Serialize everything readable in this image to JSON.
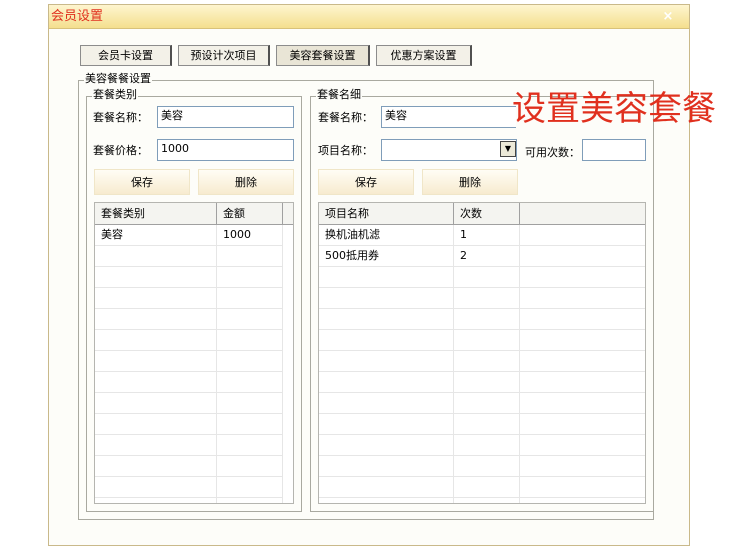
{
  "window": {
    "title": "会员设置",
    "close": "×"
  },
  "tabs": [
    {
      "label": "会员卡设置"
    },
    {
      "label": "预设计次项目"
    },
    {
      "label": "美容套餐设置"
    },
    {
      "label": "优惠方案设置"
    }
  ],
  "group": {
    "legend": "美容餐餐设置"
  },
  "left": {
    "legend": "套餐类别",
    "name_label": "套餐名称：",
    "name_value": "美容",
    "price_label": "套餐价格：",
    "price_value": "1000",
    "save": "保存",
    "delete": "删除",
    "columns": [
      "套餐类别",
      "金额"
    ],
    "rows": [
      [
        "美容",
        "1000"
      ]
    ]
  },
  "right": {
    "legend": "套餐名细",
    "name_label": "套餐名称：",
    "name_value": "美容",
    "item_label": "项目名称：",
    "item_value": "",
    "count_label": "可用次数：",
    "count_value": "",
    "save": "保存",
    "delete": "删除",
    "columns": [
      "项目名称",
      "次数"
    ],
    "rows": [
      [
        "换机油机滤",
        "1"
      ],
      [
        "500抵用券",
        "2"
      ]
    ]
  },
  "overlay_caption": "设置美容套餐",
  "colors": {
    "title": "#e0301e",
    "titlebar": "#f4df8e",
    "accent_border": "#c9b98a"
  }
}
